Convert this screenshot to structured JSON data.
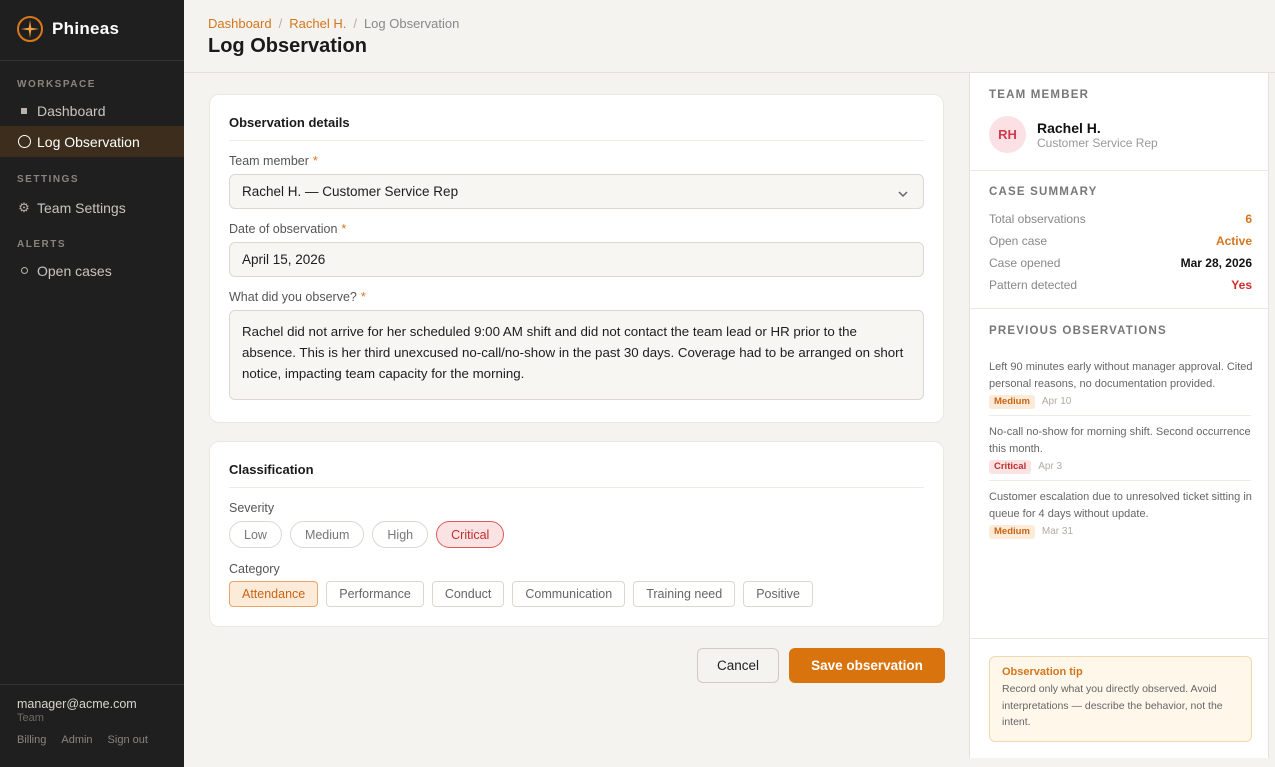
{
  "app": {
    "name": "Phineas"
  },
  "sidebar": {
    "sections": [
      {
        "label": "WORKSPACE"
      },
      {
        "label": "SETTINGS"
      },
      {
        "label": "ALERTS"
      }
    ],
    "items": [
      {
        "label": "Dashboard",
        "icon": "square-icon"
      },
      {
        "label": "Log Observation",
        "icon": "circle-icon",
        "active": true
      },
      {
        "label": "Team Settings",
        "icon": "gear-icon"
      },
      {
        "label": "Open cases",
        "icon": "circle-small-icon"
      }
    ],
    "user": {
      "email": "manager@acme.com",
      "role": "Team"
    },
    "footer_links": [
      "Billing",
      "Admin",
      "Sign out"
    ]
  },
  "header": {
    "breadcrumb": [
      "Dashboard",
      "Rachel H.",
      "Log Observation"
    ],
    "title": "Log Observation"
  },
  "details": {
    "title": "Observation details",
    "member_label": "Team member",
    "member_value": "Rachel H. — Customer Service Rep",
    "date_label": "Date of observation",
    "date_value": "April 15, 2026",
    "observe_label": "What did you observe?",
    "observe_value": "Rachel did not arrive for her scheduled 9:00 AM shift and did not contact the team lead or HR prior to the absence. This is her third unexcused no-call/no-show in the past 30 days. Coverage had to be arranged on short notice, impacting team capacity for the morning.",
    "required_mark": "*"
  },
  "classification": {
    "title": "Classification",
    "severity_label": "Severity",
    "severity_options": [
      "Low",
      "Medium",
      "High",
      "Critical"
    ],
    "severity_selected": "Critical",
    "category_label": "Category",
    "category_options": [
      "Attendance",
      "Performance",
      "Conduct",
      "Communication",
      "Training need",
      "Positive"
    ],
    "category_selected": "Attendance"
  },
  "actions": {
    "cancel": "Cancel",
    "save": "Save observation"
  },
  "panel": {
    "member_heading": "TEAM MEMBER",
    "initials": "RH",
    "name": "Rachel H.",
    "role": "Customer Service Rep",
    "summary_heading": "CASE SUMMARY",
    "summary": [
      {
        "label": "Total observations",
        "value": "6",
        "color": "#d4761c"
      },
      {
        "label": "Open case",
        "value": "Active",
        "color": "#d4761c"
      },
      {
        "label": "Case opened",
        "value": "Mar 28, 2026",
        "color": "#111111"
      },
      {
        "label": "Pattern detected",
        "value": "Yes",
        "color": "#d12c2c"
      }
    ],
    "previous_heading": "PREVIOUS OBSERVATIONS",
    "previous": [
      {
        "text": "Left 90 minutes early without manager approval. Cited personal reasons, no documentation provided.",
        "severity": "Medium",
        "date": "Apr 10"
      },
      {
        "text": "No-call no-show for morning shift. Second occurrence this month.",
        "severity": "Critical",
        "date": "Apr 3"
      },
      {
        "text": "Customer escalation due to unresolved ticket sitting in queue for 4 days without update.",
        "severity": "Medium",
        "date": "Mar 31"
      }
    ],
    "tip_title": "Observation tip",
    "tip_text": "Record only what you directly observed. Avoid interpretations — describe the behavior, not the intent."
  },
  "colors": {
    "accent": "#d9730d",
    "critical": "#c22e2e",
    "sidebar_bg": "#1f1f1f"
  }
}
